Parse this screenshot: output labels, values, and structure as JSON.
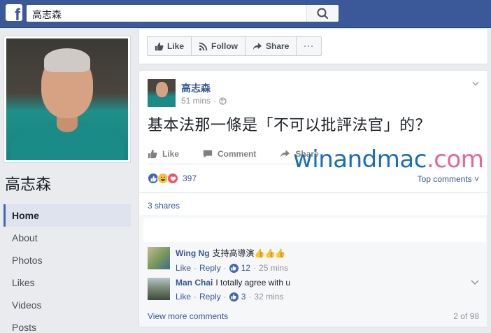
{
  "search": {
    "value": "高志森"
  },
  "page": {
    "name": "高志森"
  },
  "leftnav": [
    {
      "label": "Home",
      "active": true
    },
    {
      "label": "About"
    },
    {
      "label": "Photos"
    },
    {
      "label": "Likes"
    },
    {
      "label": "Videos"
    },
    {
      "label": "Posts"
    }
  ],
  "actions": {
    "like": "Like",
    "follow": "Follow",
    "share": "Share",
    "more": "···"
  },
  "post": {
    "author": "高志森",
    "time": "51 mins",
    "separator": "·",
    "text": "基本法那一條是「不可以批評法官」的？",
    "like_label": "Like",
    "comment_label": "Comment",
    "share_label": "Share",
    "reaction_count": "397",
    "top_comments_label": "Top comments ˅",
    "shares_label": "3 shares"
  },
  "watermark": {
    "part1": "winandmac",
    "part2": ".com"
  },
  "comments": [
    {
      "name": "Wing Ng",
      "text": "支持高導演👍👍👍",
      "like": "Like",
      "reply": "Reply",
      "likes": "12",
      "time": "25 mins"
    },
    {
      "name": "Man Chai",
      "text": "I totally agree with u",
      "like": "Like",
      "reply": "Reply",
      "likes": "3",
      "time": "32 mins"
    }
  ],
  "footer": {
    "view_more": "View more comments",
    "pager": "2 of 98"
  },
  "colors": {
    "brand": "#3b5998",
    "link": "#365899",
    "nav_active_bg": "#dfe3ee"
  }
}
